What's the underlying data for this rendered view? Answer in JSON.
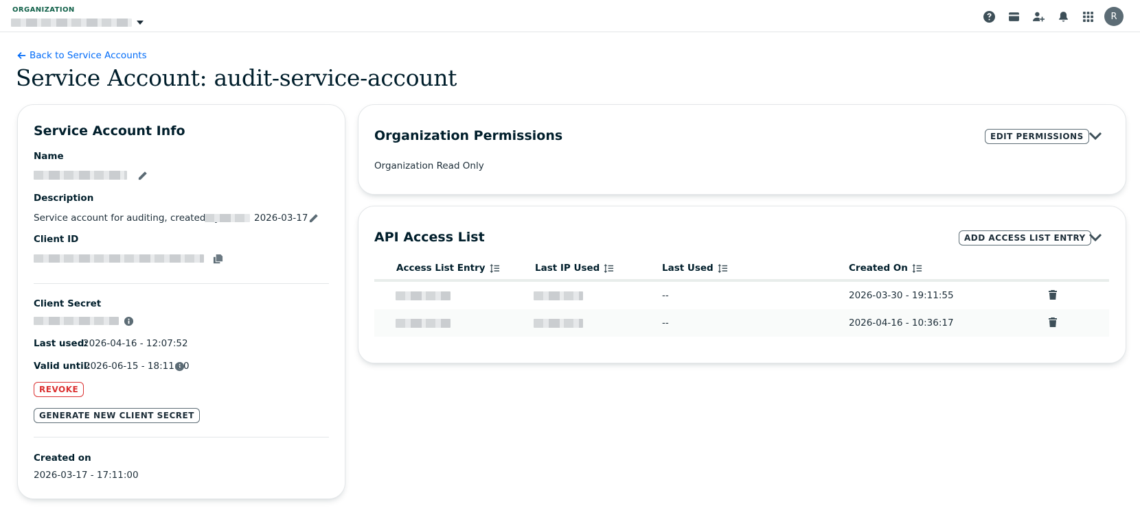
{
  "topbar": {
    "org_label": "ORGANIZATION",
    "icons": [
      "help-icon",
      "billing-card-icon",
      "invite-user-icon",
      "notifications-bell-icon",
      "apps-grid-icon"
    ],
    "avatar_initial": "R"
  },
  "header": {
    "back_link": "Back to Service Accounts",
    "title": "Service Account: audit-service-account"
  },
  "info_card": {
    "title": "Service Account Info",
    "name_label": "Name",
    "description_label": "Description",
    "description_prefix": "Service account for auditing, created by",
    "description_date": "2026-03-17",
    "client_id_label": "Client ID",
    "client_secret_label": "Client Secret",
    "last_used_label": "Last used:",
    "last_used_value": "2026-04-16 - 12:07:52",
    "valid_until_label": "Valid until:",
    "valid_until_value": "2026-06-15 - 18:11:00",
    "revoke_button": "REVOKE",
    "generate_button": "GENERATE NEW CLIENT SECRET",
    "created_on_label": "Created on",
    "created_on_value": "2026-03-17 - 17:11:00"
  },
  "permissions_card": {
    "title": "Organization Permissions",
    "edit_button": "EDIT PERMISSIONS",
    "value": "Organization Read Only"
  },
  "api_card": {
    "title": "API Access List",
    "add_button": "ADD ACCESS LIST ENTRY",
    "columns": [
      "Access List Entry",
      "Last IP Used",
      "Last Used",
      "Created On"
    ],
    "rows": [
      {
        "last_used": "--",
        "created_on": "2026-03-30 - 19:11:55"
      },
      {
        "last_used": "--",
        "created_on": "2026-04-16 - 10:36:17"
      }
    ]
  },
  "colors": {
    "accent_link": "#016bf8",
    "org_label": "#116149",
    "danger": "#db3030"
  }
}
